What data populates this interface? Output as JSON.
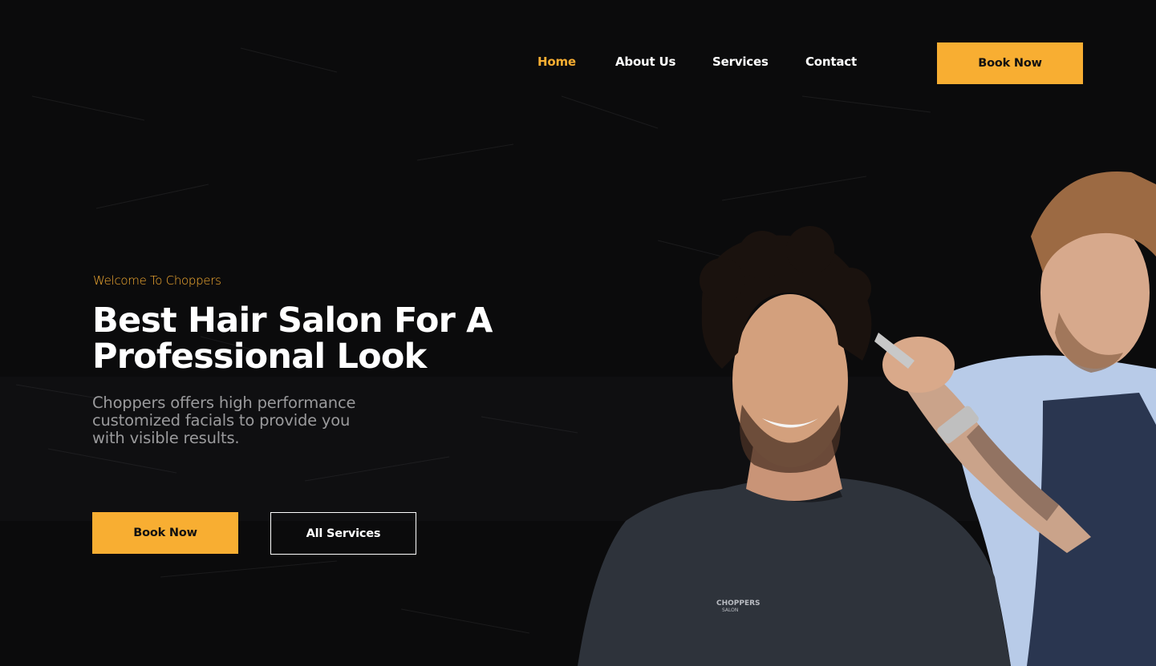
{
  "nav": {
    "items": [
      {
        "label": "Home",
        "active": true
      },
      {
        "label": "About Us",
        "active": false
      },
      {
        "label": "Services",
        "active": false
      },
      {
        "label": "Contact",
        "active": false
      }
    ],
    "book_label": "Book Now"
  },
  "hero": {
    "welcome": "Welcome To Choppers",
    "headline_line1": "Best Hair Salon For A",
    "headline_line2": "Professional Look",
    "subtext_line1": "Choppers offers high performance",
    "subtext_line2": "customized facials to provide you",
    "subtext_line3": "with visible results.",
    "book_label": "Book Now",
    "services_label": "All Services"
  },
  "photo": {
    "cape_logo_line1": "CHOPPERS",
    "cape_logo_line2": "SALON"
  },
  "colors": {
    "accent": "#f8ae32",
    "background": "#0b0b0c",
    "text": "#ffffff",
    "muted": "#9a9a9c"
  }
}
